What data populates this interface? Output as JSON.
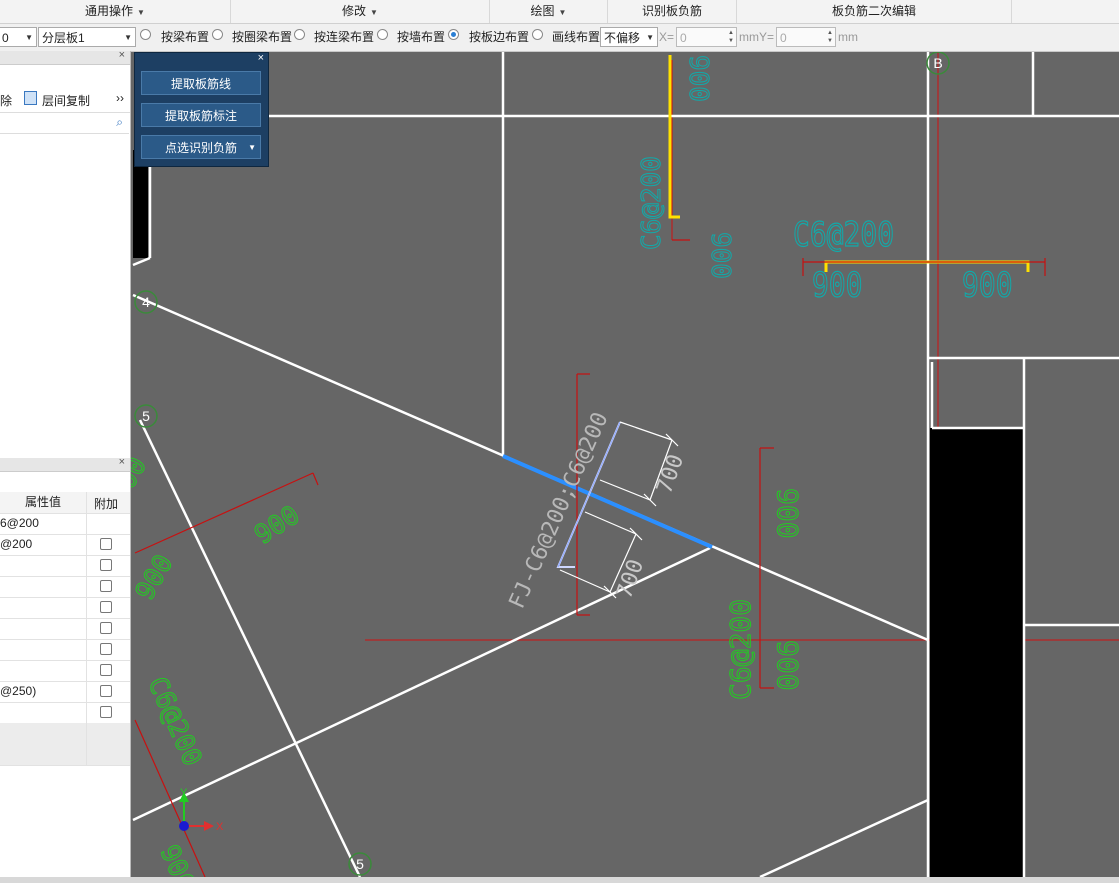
{
  "menu": {
    "items": [
      {
        "label": "通用操作",
        "has_arrow": true
      },
      {
        "label": "修改",
        "has_arrow": true
      },
      {
        "label": "绘图",
        "has_arrow": true
      },
      {
        "label": "识别板负筋",
        "has_arrow": false
      },
      {
        "label": "板负筋二次编辑",
        "has_arrow": false
      }
    ]
  },
  "toolbar": {
    "combo1_value": "0",
    "combo2_value": "分层板1",
    "radios": [
      {
        "label": "按梁布置",
        "checked": false
      },
      {
        "label": "按圈梁布置",
        "checked": false
      },
      {
        "label": "按连梁布置",
        "checked": false
      },
      {
        "label": "按墙布置",
        "checked": false
      },
      {
        "label": "按板边布置",
        "checked": true
      },
      {
        "label": "画线布置",
        "checked": false
      }
    ],
    "offset_value": "不偏移",
    "x_label": "X=",
    "x_value": "0",
    "mm_y_label": "mmY=",
    "y_value": "0",
    "mm_label": "mm"
  },
  "left_panel": {
    "actions": {
      "delete_fragment": "除",
      "copy_floor": "层间复制",
      "more": "››"
    },
    "props_headers": {
      "value": "属性值",
      "extra": "附加"
    },
    "props_rows": [
      {
        "value": "6@200",
        "checkbox": false
      },
      {
        "value": "@200",
        "checkbox": true
      },
      {
        "value": "",
        "checkbox": true
      },
      {
        "value": "",
        "checkbox": true
      },
      {
        "value": "",
        "checkbox": true
      },
      {
        "value": "",
        "checkbox": true
      },
      {
        "value": "",
        "checkbox": true
      },
      {
        "value": "",
        "checkbox": true
      },
      {
        "value": "@250)",
        "checkbox": true
      },
      {
        "value": "",
        "checkbox": true
      },
      {
        "value": "",
        "checkbox": false,
        "grey": true
      },
      {
        "value": "",
        "checkbox": false,
        "grey": true
      }
    ]
  },
  "float_panel": {
    "btn1": "提取板筋线",
    "btn2": "提取板筋标注",
    "btn3": "点选识别负筋"
  },
  "cad": {
    "axis_labels": {
      "b": "B",
      "four": "4",
      "five_a": "5",
      "five_b": "5"
    },
    "labels": {
      "l900": "900",
      "rebar": "C6@200",
      "fj": "FJ-C6@200;C6@200",
      "l700": "700"
    },
    "ucs": {
      "x": "X",
      "y": "Y"
    }
  }
}
